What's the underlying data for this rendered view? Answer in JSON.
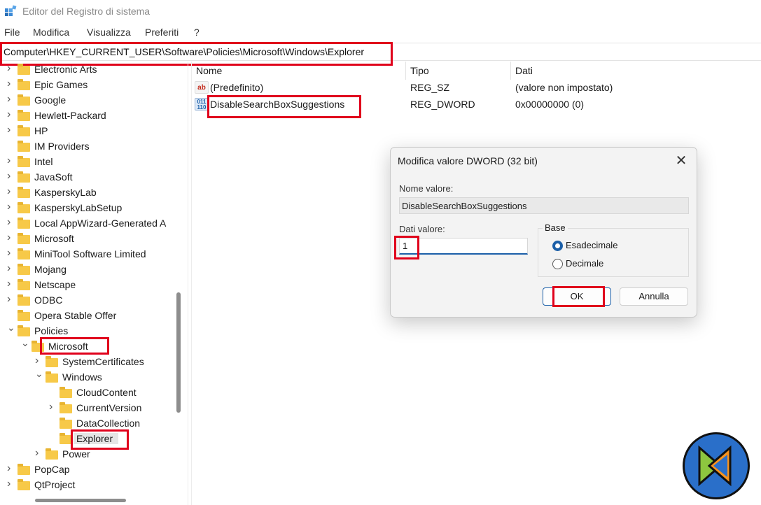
{
  "window": {
    "title": "Editor del Registro di sistema"
  },
  "menu": [
    "File",
    "Modifica",
    "Visualizza",
    "Preferiti",
    "?"
  ],
  "address": "Computer\\HKEY_CURRENT_USER\\Software\\Policies\\Microsoft\\Windows\\Explorer",
  "tree": [
    {
      "label": "Electronic Arts",
      "expander": "right"
    },
    {
      "label": "Epic Games",
      "expander": "right"
    },
    {
      "label": "Google",
      "expander": "right"
    },
    {
      "label": "Hewlett-Packard",
      "expander": "right"
    },
    {
      "label": "HP",
      "expander": "right"
    },
    {
      "label": "IM Providers",
      "expander": "none"
    },
    {
      "label": "Intel",
      "expander": "right"
    },
    {
      "label": "JavaSoft",
      "expander": "right"
    },
    {
      "label": "KasperskyLab",
      "expander": "right"
    },
    {
      "label": "KasperskyLabSetup",
      "expander": "right"
    },
    {
      "label": "Local AppWizard-Generated A",
      "expander": "right"
    },
    {
      "label": "Microsoft",
      "expander": "right"
    },
    {
      "label": "MiniTool Software Limited",
      "expander": "right"
    },
    {
      "label": "Mojang",
      "expander": "right"
    },
    {
      "label": "Netscape",
      "expander": "right"
    },
    {
      "label": "ODBC",
      "expander": "right"
    },
    {
      "label": "Opera Stable Offer",
      "expander": "none"
    },
    {
      "label": "Policies",
      "expander": "down"
    },
    {
      "label": "Microsoft",
      "expander": "down"
    },
    {
      "label": "SystemCertificates",
      "expander": "right"
    },
    {
      "label": "Windows",
      "expander": "down"
    },
    {
      "label": "CloudContent",
      "expander": "none"
    },
    {
      "label": "CurrentVersion",
      "expander": "right"
    },
    {
      "label": "DataCollection",
      "expander": "none"
    },
    {
      "label": "Explorer",
      "expander": "none"
    },
    {
      "label": "Power",
      "expander": "right"
    },
    {
      "label": "PopCap",
      "expander": "right"
    },
    {
      "label": "QtProject",
      "expander": "right"
    }
  ],
  "list": {
    "columns": [
      "Nome",
      "Tipo",
      "Dati"
    ],
    "rows": [
      {
        "name": "(Predefinito)",
        "type": "REG_SZ",
        "data": "(valore non impostato)",
        "icon": "ab"
      },
      {
        "name": "DisableSearchBoxSuggestions",
        "type": "REG_DWORD",
        "data": "0x00000000 (0)",
        "icon": "011 110"
      }
    ]
  },
  "dialog": {
    "title": "Modifica valore DWORD (32 bit)",
    "name_label": "Nome valore:",
    "name_value": "DisableSearchBoxSuggestions",
    "data_label": "Dati valore:",
    "data_value": "1",
    "base_label": "Base",
    "hex_label": "Esadecimale",
    "dec_label": "Decimale",
    "ok_label": "OK",
    "cancel_label": "Annulla"
  },
  "colors": {
    "highlight": "#e0001b",
    "accent": "#1b5fa8",
    "folder": "#f7c948"
  }
}
